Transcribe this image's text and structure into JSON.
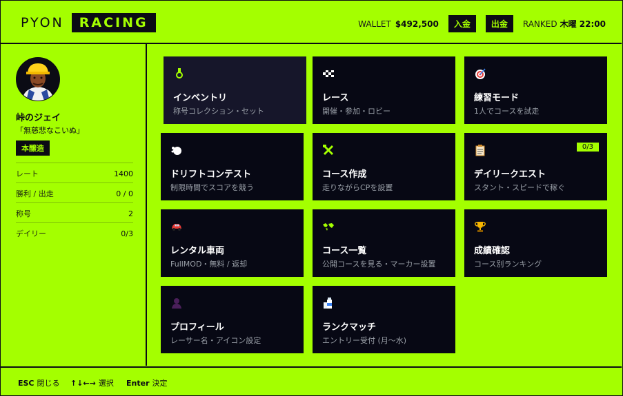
{
  "header": {
    "logo_left": "PYON",
    "logo_right": "RACING",
    "wallet_label": "WALLET",
    "wallet_amount": "$492,500",
    "deposit_label": "入金",
    "withdraw_label": "出金",
    "ranked_label": "RANKED",
    "ranked_time": "木曜 22:00"
  },
  "profile": {
    "name": "峠のジェイ",
    "tagline": "「無慈悲なこいぬ」",
    "badge": "本醸造",
    "stats": [
      {
        "label": "レート",
        "value": "1400"
      },
      {
        "label": "勝利 / 出走",
        "value": "0 / 0"
      },
      {
        "label": "称号",
        "value": "2"
      },
      {
        "label": "デイリー",
        "value": "0/3"
      }
    ]
  },
  "cards": [
    {
      "title": "インベントリ",
      "subtitle": "称号コレクション・セット",
      "icon": "medal-icon"
    },
    {
      "title": "レース",
      "subtitle": "開催・参加・ロビー",
      "icon": "checkered-flag-icon"
    },
    {
      "title": "練習モード",
      "subtitle": "1人でコースを試走",
      "icon": "target-icon"
    },
    {
      "title": "ドリフトコンテスト",
      "subtitle": "制限時間でスコアを競う",
      "icon": "dash-smoke-icon"
    },
    {
      "title": "コース作成",
      "subtitle": "走りながらCPを設置",
      "icon": "tools-icon"
    },
    {
      "title": "デイリークエスト",
      "subtitle": "スタント・スピードで稼ぐ",
      "icon": "clipboard-icon",
      "badge": "0/3"
    },
    {
      "title": "レンタル車両",
      "subtitle": "FullMOD・無料 / 返却",
      "icon": "car-icon"
    },
    {
      "title": "コース一覧",
      "subtitle": "公開コースを見る・マーカー設置",
      "icon": "world-map-icon"
    },
    {
      "title": "成績確認",
      "subtitle": "コース別ランキング",
      "icon": "trophy-icon"
    },
    {
      "title": "プロフィール",
      "subtitle": "レーサー名・アイコン設定",
      "icon": "person-icon"
    },
    {
      "title": "ランクマッチ",
      "subtitle": "エントリー受付 (月〜水)",
      "icon": "milk-icon"
    }
  ],
  "footer": [
    {
      "key": "ESC",
      "label": "閉じる"
    },
    {
      "key": "↑↓←→",
      "label": "選択"
    },
    {
      "key": "Enter",
      "label": "決定"
    }
  ],
  "colors": {
    "accent": "#a4ff00",
    "card_bg": "#070814",
    "card_selected_bg": "#16162a"
  }
}
